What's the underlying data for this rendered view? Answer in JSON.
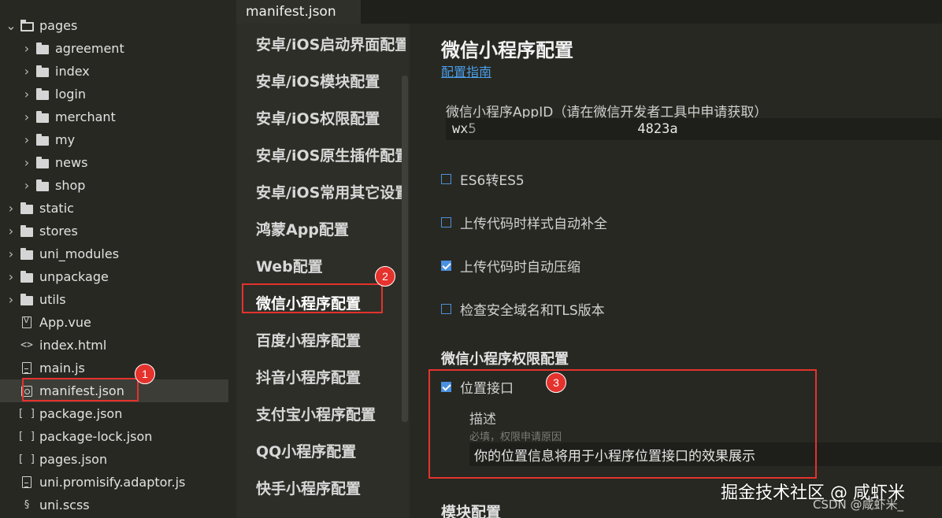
{
  "file_tree": {
    "items": [
      {
        "label": "pages",
        "kind": "folder-open",
        "chevron": "down"
      },
      {
        "label": "agreement",
        "kind": "folder",
        "chevron": "right"
      },
      {
        "label": "index",
        "kind": "folder",
        "chevron": "right"
      },
      {
        "label": "login",
        "kind": "folder",
        "chevron": "right"
      },
      {
        "label": "merchant",
        "kind": "folder",
        "chevron": "right"
      },
      {
        "label": "my",
        "kind": "folder",
        "chevron": "right"
      },
      {
        "label": "news",
        "kind": "folder",
        "chevron": "right"
      },
      {
        "label": "shop",
        "kind": "folder",
        "chevron": "right"
      },
      {
        "label": "static",
        "kind": "folder",
        "chevron": "right"
      },
      {
        "label": "stores",
        "kind": "folder",
        "chevron": "right"
      },
      {
        "label": "uni_modules",
        "kind": "folder",
        "chevron": "right"
      },
      {
        "label": "unpackage",
        "kind": "folder",
        "chevron": "right"
      },
      {
        "label": "utils",
        "kind": "folder",
        "chevron": "right"
      },
      {
        "label": "App.vue",
        "kind": "vue-file-icon"
      },
      {
        "label": "index.html",
        "kind": "html-file-icon",
        "glyph": "<>"
      },
      {
        "label": "main.js",
        "kind": "js-file-icon"
      },
      {
        "label": "manifest.json",
        "kind": "settings-file-icon"
      },
      {
        "label": "package.json",
        "kind": "json-file-icon",
        "glyph": "[ ]"
      },
      {
        "label": "package-lock.json",
        "kind": "json-file-icon",
        "glyph": "[ ]"
      },
      {
        "label": "pages.json",
        "kind": "json-file-icon",
        "glyph": "[ ]"
      },
      {
        "label": "uni.promisify.adaptor.js",
        "kind": "js-file-icon"
      },
      {
        "label": "uni.scss",
        "kind": "scss-file-icon",
        "glyph": "§"
      }
    ]
  },
  "annotations": {
    "badge1": "1",
    "badge2": "2",
    "badge3": "3",
    "highlight_color": "#e5322d"
  },
  "editor": {
    "tab_label": "manifest.json"
  },
  "settings_nav": {
    "items": [
      "安卓/iOS启动界面配置",
      "安卓/iOS模块配置",
      "安卓/iOS权限配置",
      "安卓/iOS原生插件配置",
      "安卓/iOS常用其它设置",
      "鸿蒙App配置",
      "Web配置",
      "微信小程序配置",
      "百度小程序配置",
      "抖音小程序配置",
      "支付宝小程序配置",
      "QQ小程序配置",
      "快手小程序配置"
    ],
    "active_index": 7
  },
  "config": {
    "title": "微信小程序配置",
    "guide_link": "配置指南",
    "appid_label": "微信小程序AppID（请在微信开发者工具中申请获取）",
    "appid_value": "wx5                    4823a",
    "options": [
      {
        "label": "ES6转ES5",
        "checked": false
      },
      {
        "label": "上传代码时样式自动补全",
        "checked": false
      },
      {
        "label": "上传代码时自动压缩",
        "checked": true
      },
      {
        "label": "检查安全域名和TLS版本",
        "checked": false
      }
    ],
    "permission_title": "微信小程序权限配置",
    "location_permission": {
      "label": "位置接口",
      "checked": true
    },
    "desc_label": "描述",
    "desc_hint": "必填，权限申请原因",
    "desc_value": "你的位置信息将用于小程序位置接口的效果展示",
    "module_title": "模块配置",
    "accent_color": "#4a90e2",
    "link_color": "#4a9de8"
  },
  "watermark": {
    "text": "掘金技术社区 @ 咸虾米",
    "sub": "CSDN @咸虾米_"
  }
}
